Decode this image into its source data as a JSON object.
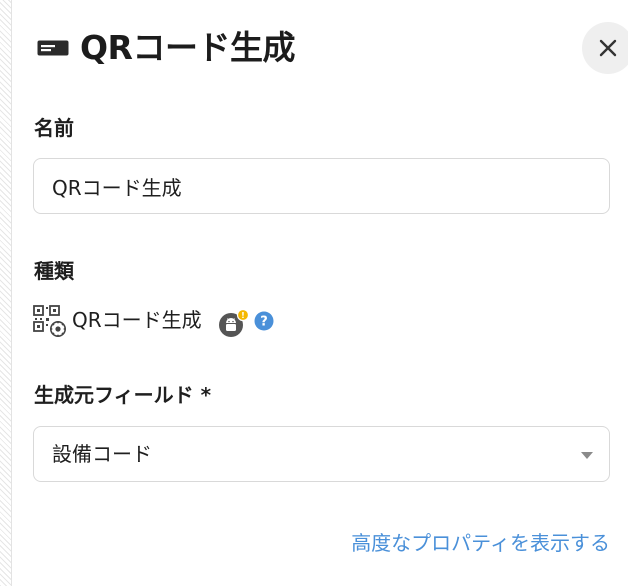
{
  "panel": {
    "title": "QRコード生成",
    "title_icon": "card-icon",
    "close_icon": "close-icon"
  },
  "fields": {
    "name": {
      "label": "名前",
      "value": "QRコード生成"
    },
    "type": {
      "label": "種類",
      "value": "QRコード生成",
      "type_icon": "qr-code-gear-icon",
      "badge_icon": "android-icon",
      "badge_notice": "!",
      "help_icon": "question-icon",
      "help_glyph": "?"
    },
    "source_field": {
      "label": "生成元フィールド *",
      "value": "設備コード"
    }
  },
  "advanced_link": "高度なプロパティを表示する",
  "colors": {
    "accent": "#4a90d9",
    "help_blue": "#4a90d9",
    "badge_warning": "#f5b800",
    "android_badge": "#555555",
    "border": "#d9d9d9"
  }
}
